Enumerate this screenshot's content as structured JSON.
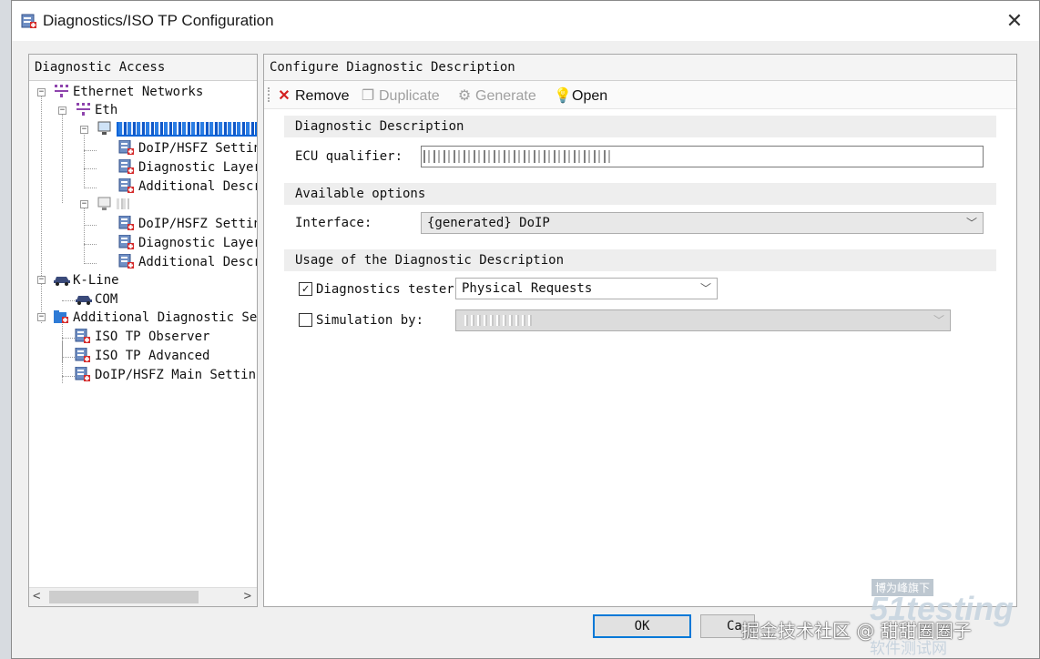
{
  "window": {
    "title": "Diagnostics/ISO TP Configuration"
  },
  "left_panel": {
    "header": "Diagnostic Access",
    "tree": {
      "ethernet_networks": "Ethernet Networks",
      "eth": "Eth",
      "node1_doip": "DoIP/HSFZ Settin",
      "node1_diag_layer": "Diagnostic Layer",
      "node1_additional": "Additional Descr",
      "node2_doip": "DoIP/HSFZ Settin",
      "node2_diag_layer": "Diagnostic Layer",
      "node2_additional": "Additional Descr",
      "k_line": "K-Line",
      "com": "COM",
      "additional_diag": "Additional Diagnostic Se",
      "iso_tp_observer": "ISO TP Observer",
      "iso_tp_advanced": "ISO TP Advanced",
      "doip_main": "DoIP/HSFZ Main Settin"
    }
  },
  "right_panel": {
    "header": "Configure Diagnostic Description",
    "toolbar": {
      "remove": "Remove",
      "duplicate": "Duplicate",
      "generate": "Generate",
      "open": "Open"
    },
    "sections": {
      "diag_desc": "Diagnostic Description",
      "available_options": "Available options",
      "usage": "Usage of the Diagnostic Description"
    },
    "ecu_qualifier_label": "ECU qualifier:",
    "interface_label": "Interface:",
    "interface_value": "{generated} DoIP",
    "diagnostics_tester_label": "Diagnostics tester",
    "diagnostics_tester_value": "Physical Requests",
    "simulation_label": "Simulation by:"
  },
  "buttons": {
    "ok": "OK",
    "cancel": "Ca"
  },
  "watermark": {
    "badge": "博为峰旗下",
    "brand": "51testing",
    "text": "掘金技术社区 @ 甜甜圈圈子",
    "sub": "软件测试网"
  }
}
